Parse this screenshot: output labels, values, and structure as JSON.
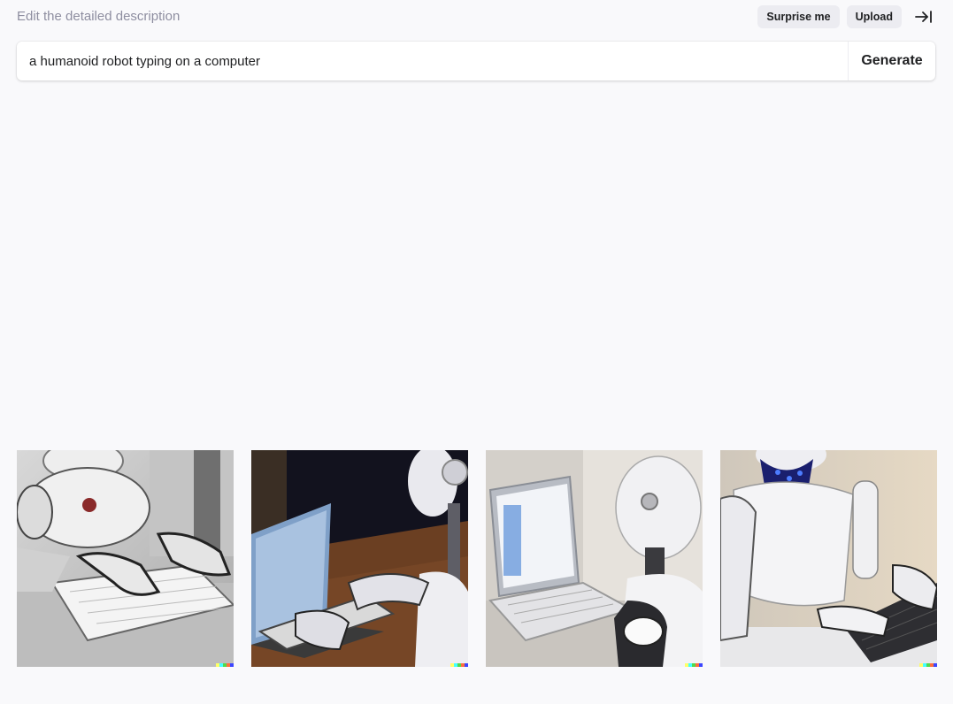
{
  "header": {
    "hint": "Edit the detailed description",
    "surprise_label": "Surprise me",
    "upload_label": "Upload",
    "collapse_icon": "arrow-right-to-line-icon"
  },
  "prompt": {
    "value": "a humanoid robot typing on a computer",
    "generate_label": "Generate"
  },
  "results": {
    "images": [
      {
        "subject": "white robot typing on white keyboard, greyscale"
      },
      {
        "subject": "robot at laptop on wooden desk, dark background"
      },
      {
        "subject": "robot head facing laptop screen"
      },
      {
        "subject": "robot with blue lights typing on laptop keyboard"
      }
    ],
    "signature_colors": [
      "#ffff66",
      "#42ffff",
      "#51da4c",
      "#ff6e3c",
      "#3c46ff"
    ]
  }
}
